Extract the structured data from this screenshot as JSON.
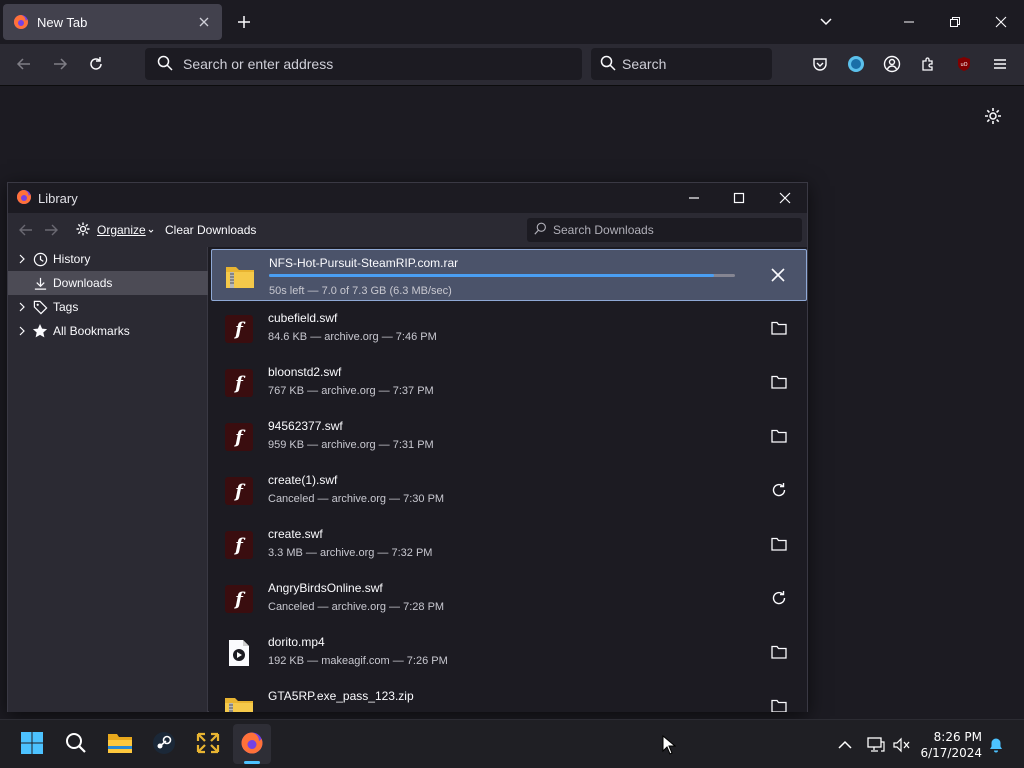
{
  "browser": {
    "tab_title": "New Tab",
    "url_placeholder": "Search or enter address",
    "search_placeholder": "Search"
  },
  "library": {
    "window_title": "Library",
    "organize_label": "Organize",
    "clear_downloads_label": "Clear Downloads",
    "search_placeholder": "Search Downloads",
    "sidebar": [
      {
        "label": "History",
        "icon": "clock-icon",
        "expandable": true,
        "selected": false
      },
      {
        "label": "Downloads",
        "icon": "download-icon",
        "expandable": false,
        "selected": true
      },
      {
        "label": "Tags",
        "icon": "tag-icon",
        "expandable": true,
        "selected": false
      },
      {
        "label": "All Bookmarks",
        "icon": "star-icon",
        "expandable": true,
        "selected": false
      }
    ],
    "downloads": [
      {
        "name": "NFS-Hot-Pursuit-SteamRIP.com.rar",
        "status": "50s left — 7.0 of 7.3 GB (6.3 MB/sec)",
        "icon": "zip-folder-icon",
        "action": "cancel",
        "progress": 0.955
      },
      {
        "name": "cubefield.swf",
        "status": "84.6 KB — archive.org — 7:46 PM",
        "icon": "flash-icon",
        "action": "show-in-folder"
      },
      {
        "name": "bloonstd2.swf",
        "status": "767 KB — archive.org — 7:37 PM",
        "icon": "flash-icon",
        "action": "show-in-folder"
      },
      {
        "name": "94562377.swf",
        "status": "959 KB — archive.org — 7:31 PM",
        "icon": "flash-icon",
        "action": "show-in-folder"
      },
      {
        "name": "create(1).swf",
        "status": "Canceled — archive.org — 7:30 PM",
        "icon": "flash-icon",
        "action": "retry"
      },
      {
        "name": "create.swf",
        "status": "3.3 MB — archive.org — 7:32 PM",
        "icon": "flash-icon",
        "action": "show-in-folder"
      },
      {
        "name": "AngryBirdsOnline.swf",
        "status": "Canceled — archive.org — 7:28 PM",
        "icon": "flash-icon",
        "action": "retry"
      },
      {
        "name": "dorito.mp4",
        "status": "192 KB — makeagif.com — 7:26 PM",
        "icon": "video-file-icon",
        "action": "show-in-folder"
      },
      {
        "name": "GTA5RP.exe_pass_123.zip",
        "status": "",
        "icon": "zip-folder-icon",
        "action": "show-in-folder"
      }
    ]
  },
  "taskbar": {
    "time": "8:26 PM",
    "date": "6/17/2024"
  },
  "colors": {
    "accent": "#4a9ef2",
    "selection": "#4b536a",
    "flash_bg": "#3a0d0f"
  }
}
